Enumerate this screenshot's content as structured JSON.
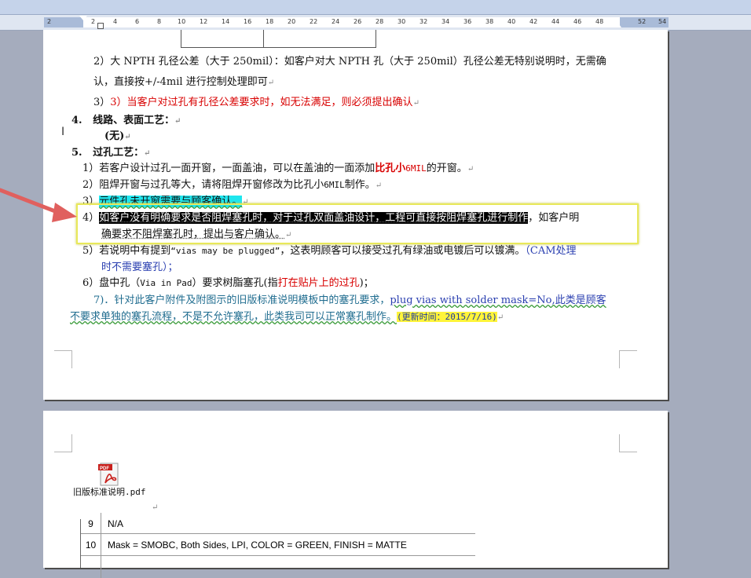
{
  "ruler": {
    "left_value": "2",
    "numbers": [
      "2",
      "4",
      "6",
      "8",
      "10",
      "12",
      "14",
      "16",
      "18",
      "20",
      "22",
      "24",
      "26",
      "28",
      "30",
      "32",
      "34",
      "36",
      "38",
      "40",
      "42",
      "44",
      "46",
      "48",
      "52",
      "54"
    ]
  },
  "doc": {
    "l1_a": "2）大 NPTH 孔径公差（大于 250mil）：如客户对大 NPTH 孔（大于 250mil）孔径公差无特别说明时，无需确",
    "l1_b": "认，直接按+/-4mil 进行控制处理即可",
    "l2": "3）当客户对过孔有孔径公差要求时，如无法满足，则必须提出确认",
    "s4_num": "4.",
    "s4_title": "线路、表面工艺：",
    "s4_body": "(无)",
    "s5_num": "5.",
    "s5_title": "过孔工艺：",
    "i1_a": "1）若客户设计过孔一面开窗，一面盖油，可以在盖油的一面添加",
    "i1_b": "比孔小",
    "i1_c": "6MIL",
    "i1_d": "的开窗。",
    "i2_a": "2）阻焊开窗与过孔等大，请将阻焊开窗修改为比孔小",
    "i2_b": "6MIL",
    "i2_c": "制作。",
    "i3_a": "3）",
    "i3_b": "元件孔未开窗需要与顾客确认。",
    "i4_num": "4）",
    "i4_sel": "如客户没有明确要求是否阻焊塞孔时，对于过孔双面盖油设计，工程可直接按阻焊塞孔进行制作",
    "i4_rest": "，如客户明",
    "i4_line2": "确要求不阻焊塞孔时，提出与客户确认。",
    "i5_a": "5）若说明中有提到",
    "i5_b": "“vias may be plugged”",
    "i5_c": "，这表明顾客可以接受过孔有绿油或电镀后可以镀满。",
    "i5_d": "（CAM处理",
    "i5_line2": "时不需要塞孔）；",
    "i6_a": "6）盘中孔（",
    "i6_b": "Via in Pad",
    "i6_c": "）要求树脂塞孔(指",
    "i6_d": "打在贴片上的过孔",
    "i6_e": ")；",
    "i7_a": "7)．针对此客户附件及附图示的旧版标准说明模板中的塞孔要求，",
    "i7_b": "plug vias with solder mask=No,此类是顾客",
    "i7_line2_a": "不要求单独的塞孔流程，不是不允许塞孔，此类我司可以正常塞孔制作。",
    "i7_line2_b": "(更新时间：2015/7/16)"
  },
  "page2": {
    "attachment_name": "旧版标准说明.pdf",
    "row_partial_num": "9",
    "row_partial_txt": "N/A",
    "row10_num": "10",
    "row10_txt": "Mask = SMOBC, Both Sides, LPI, COLOR = GREEN, FINISH = MATTE"
  },
  "colors": {
    "red": "#d80000",
    "blue": "#2a3fb0",
    "highlight_cyan": "#1fe6ee",
    "highlight_yellow": "#fff43a",
    "annotation_box": "#e8e85a",
    "arrow": "#e0605e"
  }
}
